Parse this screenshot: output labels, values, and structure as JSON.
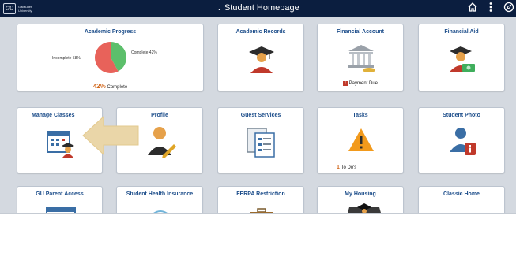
{
  "header": {
    "logo_mark": "GU",
    "logo_text": "Gallaudet University",
    "title": "Student Homepage",
    "icons": [
      "home-icon",
      "more-vert-icon",
      "nav-compass-icon"
    ]
  },
  "tiles": {
    "academic_progress": {
      "title": "Academic Progress",
      "incomplete_label": "Incomplete 58%",
      "complete_label": "Complete 42%",
      "percent": "42%",
      "complete_word": "Complete",
      "chart_data": {
        "type": "pie",
        "categories": [
          "Complete",
          "Incomplete"
        ],
        "values": [
          42,
          58
        ]
      },
      "colors": {
        "complete": "#5cbf6b",
        "incomplete": "#e8625a"
      }
    },
    "academic_records": {
      "title": "Academic Records"
    },
    "financial_account": {
      "title": "Financial Account",
      "badge": "!",
      "note": "Payment Due"
    },
    "financial_aid": {
      "title": "Financial Aid"
    },
    "manage_classes": {
      "title": "Manage Classes"
    },
    "profile": {
      "title": "Profile"
    },
    "guest_services": {
      "title": "Guest Services"
    },
    "tasks": {
      "title": "Tasks",
      "count": "1",
      "note": "To Do's"
    },
    "student_photo": {
      "title": "Student Photo"
    },
    "gu_parent_access": {
      "title": "GU Parent Access"
    },
    "student_health_insurance": {
      "title": "Student Health Insurance"
    },
    "ferpa_restriction": {
      "title": "FERPA Restriction"
    },
    "my_housing": {
      "title": "My Housing"
    },
    "classic_home": {
      "title": "Classic Home"
    }
  },
  "colors": {
    "navy": "#0b1e3f",
    "title_blue": "#1c4d8a",
    "accent_orange": "#d2691e",
    "arrow": "#ead6a8"
  }
}
